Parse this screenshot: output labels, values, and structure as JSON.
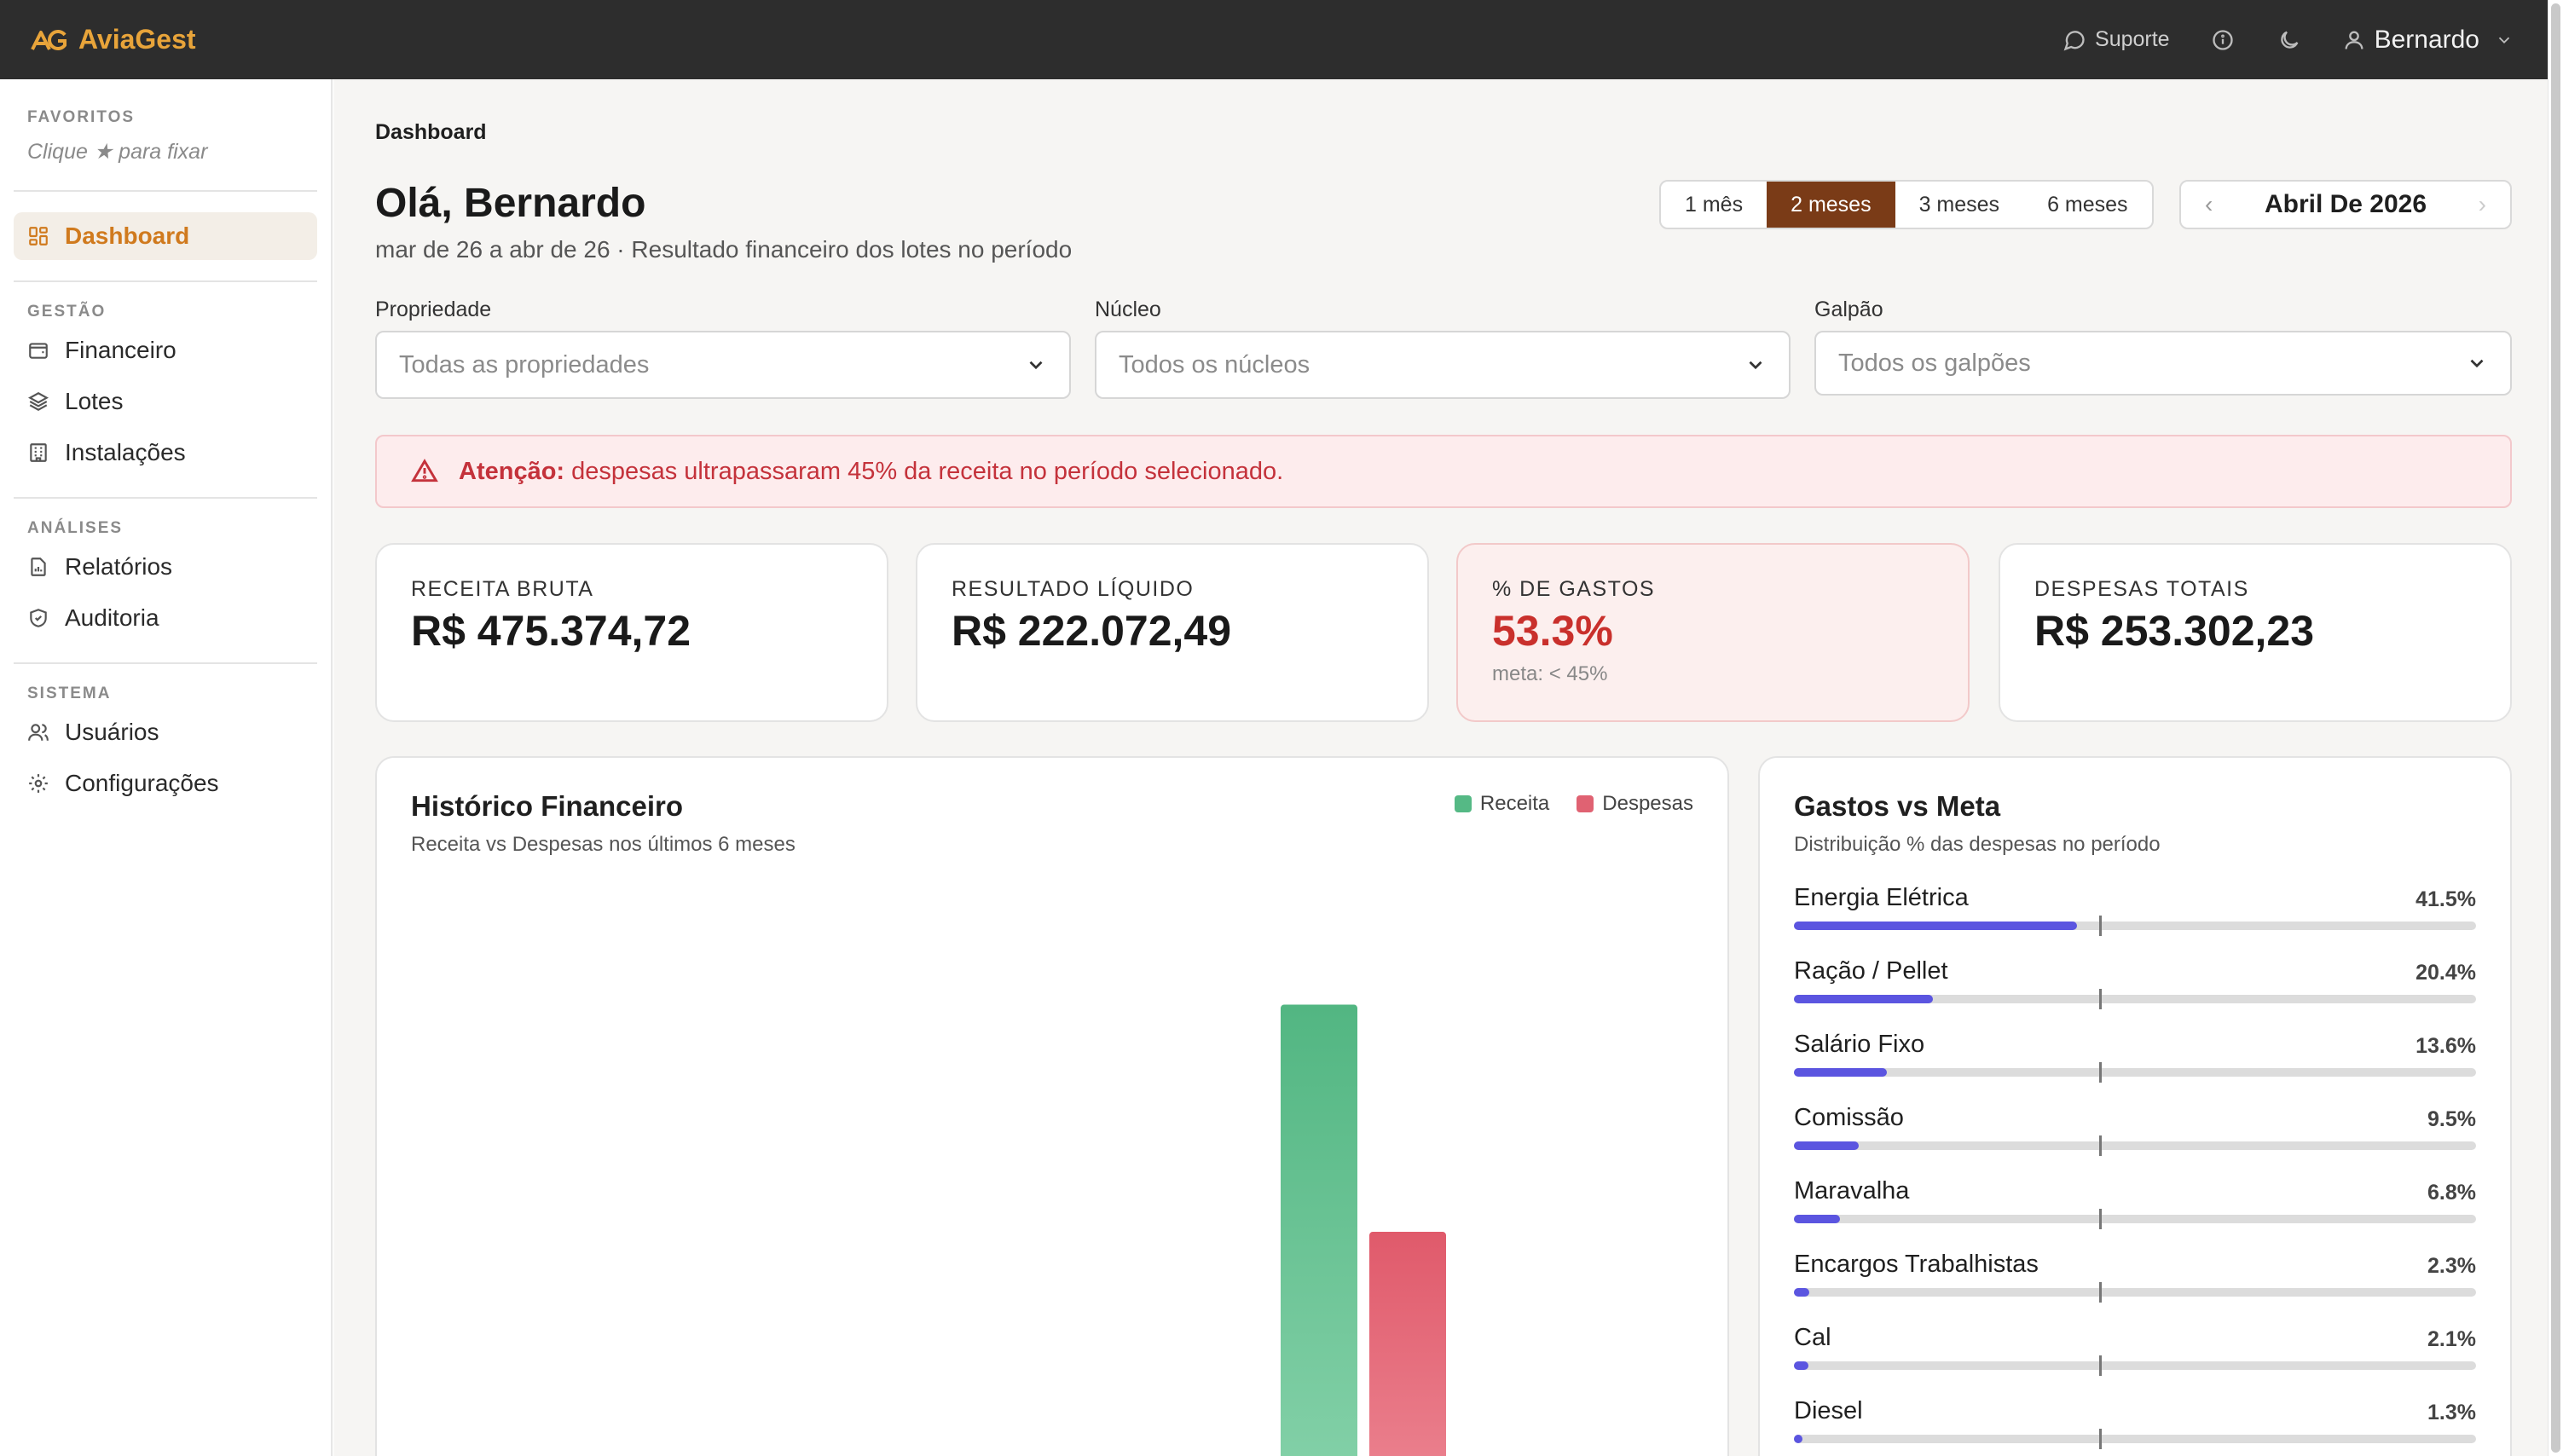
{
  "topbar": {
    "brand": "AviaGest",
    "support": "Suporte",
    "user": "Bernardo"
  },
  "sidebar": {
    "favorites_title": "FAVORITOS",
    "favorites_hint": "Clique ★ para fixar",
    "dashboard": "Dashboard",
    "sections": [
      {
        "title": "GESTÃO",
        "items": [
          {
            "label": "Financeiro",
            "icon": "wallet-icon"
          },
          {
            "label": "Lotes",
            "icon": "layers-icon"
          },
          {
            "label": "Instalações",
            "icon": "building-icon"
          }
        ]
      },
      {
        "title": "ANÁLISES",
        "items": [
          {
            "label": "Relatórios",
            "icon": "file-chart-icon"
          },
          {
            "label": "Auditoria",
            "icon": "shield-check-icon"
          }
        ]
      },
      {
        "title": "SISTEMA",
        "items": [
          {
            "label": "Usuários",
            "icon": "users-icon"
          },
          {
            "label": "Configurações",
            "icon": "gear-icon"
          }
        ]
      }
    ]
  },
  "page": {
    "breadcrumb": "Dashboard",
    "greeting": "Olá, Bernardo",
    "subtitle": "mar de 26 a abr de 26 · Resultado financeiro dos lotes no período",
    "periods": [
      "1 mês",
      "2 meses",
      "3 meses",
      "6 meses"
    ],
    "active_period": "2 meses",
    "month_label": "Abril De 2026"
  },
  "filters": [
    {
      "label": "Propriedade",
      "placeholder": "Todas as propriedades"
    },
    {
      "label": "Núcleo",
      "placeholder": "Todos os núcleos"
    },
    {
      "label": "Galpão",
      "placeholder": "Todos os galpões"
    }
  ],
  "alert": {
    "strong": "Atenção:",
    "text": "despesas ultrapassaram 45% da receita no período selecionado."
  },
  "kpis": [
    {
      "title": "RECEITA BRUTA",
      "value": "R$ 475.374,72"
    },
    {
      "title": "RESULTADO LÍQUIDO",
      "value": "R$ 222.072,49"
    },
    {
      "title": "% DE GASTOS",
      "value": "53.3%",
      "note": "meta: < 45%"
    },
    {
      "title": "DESPESAS TOTAIS",
      "value": "R$ 253.302,23"
    }
  ],
  "history_chart": {
    "title": "Histórico Financeiro",
    "subtitle": "Receita vs Despesas nos últimos 6 meses",
    "legend": [
      "Receita",
      "Despesas"
    ],
    "colors": {
      "receita": "#55b985",
      "despesas": "#e06272"
    }
  },
  "chart_data": {
    "type": "bar",
    "title": "Histórico Financeiro",
    "series": [
      {
        "name": "Receita",
        "values": [
          475374.72
        ]
      },
      {
        "name": "Despesas",
        "values": [
          253302.23
        ]
      }
    ]
  },
  "goals": {
    "title": "Gastos vs Meta",
    "subtitle": "Distribuição % das despesas no período",
    "items": [
      {
        "name": "Energia Elétrica",
        "pct": "41.5%",
        "value": 41.5
      },
      {
        "name": "Ração / Pellet",
        "pct": "20.4%",
        "value": 20.4
      },
      {
        "name": "Salário Fixo",
        "pct": "13.6%",
        "value": 13.6
      },
      {
        "name": "Comissão",
        "pct": "9.5%",
        "value": 9.5
      },
      {
        "name": "Maravalha",
        "pct": "6.8%",
        "value": 6.8
      },
      {
        "name": "Encargos Trabalhistas",
        "pct": "2.3%",
        "value": 2.3
      },
      {
        "name": "Cal",
        "pct": "2.1%",
        "value": 2.1
      },
      {
        "name": "Diesel",
        "pct": "1.3%",
        "value": 1.3
      }
    ]
  }
}
